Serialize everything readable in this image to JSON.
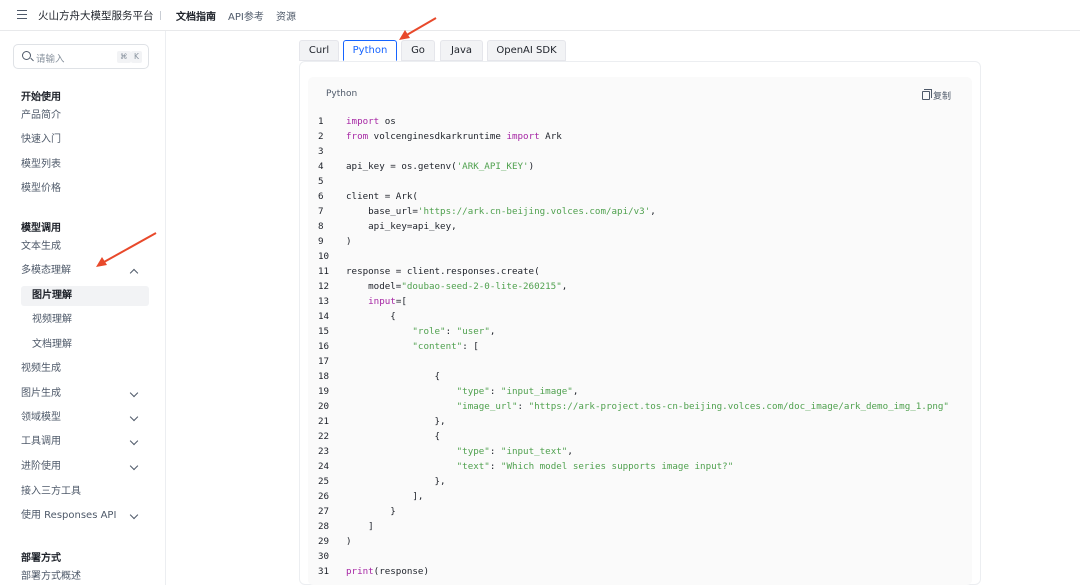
{
  "topbar": {
    "brand": "火山方舟大模型服务平台",
    "nav": [
      {
        "label": "文档指南",
        "active": true
      },
      {
        "label": "API参考",
        "active": false
      },
      {
        "label": "资源",
        "active": false
      }
    ]
  },
  "sidebar": {
    "search": {
      "placeholder": "请输入",
      "shortcut_mod": "⌘",
      "shortcut_key": "K"
    },
    "sections": [
      {
        "title": "开始使用"
      },
      {
        "title": "模型调用"
      },
      {
        "title": "部署方式"
      }
    ],
    "items": [
      {
        "label": "产品简介"
      },
      {
        "label": "快速入门"
      },
      {
        "label": "模型列表"
      },
      {
        "label": "模型价格"
      },
      {
        "label": "文本生成"
      },
      {
        "label": "多模态理解"
      },
      {
        "label": "图片理解"
      },
      {
        "label": "视频理解"
      },
      {
        "label": "文档理解"
      },
      {
        "label": "视频生成"
      },
      {
        "label": "图片生成"
      },
      {
        "label": "领域模型"
      },
      {
        "label": "工具调用"
      },
      {
        "label": "进阶使用"
      },
      {
        "label": "接入三方工具"
      },
      {
        "label": "使用 Responses API"
      },
      {
        "label": "部署方式概述"
      }
    ]
  },
  "tabs": [
    {
      "label": "Curl"
    },
    {
      "label": "Python"
    },
    {
      "label": "Go"
    },
    {
      "label": "Java"
    },
    {
      "label": "OpenAI SDK"
    }
  ],
  "code": {
    "language": "Python",
    "copy_label": "复制",
    "lines": [
      [
        {
          "t": "kw",
          "v": "import"
        },
        {
          "t": "plain",
          "v": " os"
        }
      ],
      [
        {
          "t": "kw",
          "v": "from"
        },
        {
          "t": "plain",
          "v": " volcenginesdkarkruntime "
        },
        {
          "t": "kw",
          "v": "import"
        },
        {
          "t": "plain",
          "v": " Ark"
        }
      ],
      [],
      [
        {
          "t": "plain",
          "v": "api_key = os.getenv("
        },
        {
          "t": "str",
          "v": "'ARK_API_KEY'"
        },
        {
          "t": "plain",
          "v": ")"
        }
      ],
      [],
      [
        {
          "t": "plain",
          "v": "client = Ark("
        }
      ],
      [
        {
          "t": "plain",
          "v": "    base_url="
        },
        {
          "t": "str",
          "v": "'https://ark.cn-beijing.volces.com/api/v3'"
        },
        {
          "t": "plain",
          "v": ","
        }
      ],
      [
        {
          "t": "plain",
          "v": "    api_key=api_key,"
        }
      ],
      [
        {
          "t": "plain",
          "v": ")"
        }
      ],
      [],
      [
        {
          "t": "plain",
          "v": "response = client.responses.create("
        }
      ],
      [
        {
          "t": "plain",
          "v": "    model="
        },
        {
          "t": "str",
          "v": "\"doubao-seed-2-0-lite-260215\""
        },
        {
          "t": "plain",
          "v": ","
        }
      ],
      [
        {
          "t": "plain",
          "v": "    "
        },
        {
          "t": "kw",
          "v": "input"
        },
        {
          "t": "plain",
          "v": "=["
        }
      ],
      [
        {
          "t": "plain",
          "v": "        {"
        }
      ],
      [
        {
          "t": "plain",
          "v": "            "
        },
        {
          "t": "str",
          "v": "\"role\""
        },
        {
          "t": "plain",
          "v": ": "
        },
        {
          "t": "str",
          "v": "\"user\""
        },
        {
          "t": "plain",
          "v": ","
        }
      ],
      [
        {
          "t": "plain",
          "v": "            "
        },
        {
          "t": "str",
          "v": "\"content\""
        },
        {
          "t": "plain",
          "v": ": ["
        }
      ],
      [],
      [
        {
          "t": "plain",
          "v": "                {"
        }
      ],
      [
        {
          "t": "plain",
          "v": "                    "
        },
        {
          "t": "str",
          "v": "\"type\""
        },
        {
          "t": "plain",
          "v": ": "
        },
        {
          "t": "str",
          "v": "\"input_image\""
        },
        {
          "t": "plain",
          "v": ","
        }
      ],
      [
        {
          "t": "plain",
          "v": "                    "
        },
        {
          "t": "str",
          "v": "\"image_url\""
        },
        {
          "t": "plain",
          "v": ": "
        },
        {
          "t": "str",
          "v": "\"https://ark-project.tos-cn-beijing.volces.com/doc_image/ark_demo_img_1.png\""
        }
      ],
      [
        {
          "t": "plain",
          "v": "                },"
        }
      ],
      [
        {
          "t": "plain",
          "v": "                {"
        }
      ],
      [
        {
          "t": "plain",
          "v": "                    "
        },
        {
          "t": "str",
          "v": "\"type\""
        },
        {
          "t": "plain",
          "v": ": "
        },
        {
          "t": "str",
          "v": "\"input_text\""
        },
        {
          "t": "plain",
          "v": ","
        }
      ],
      [
        {
          "t": "plain",
          "v": "                    "
        },
        {
          "t": "str",
          "v": "\"text\""
        },
        {
          "t": "plain",
          "v": ": "
        },
        {
          "t": "str",
          "v": "\"Which model series supports image input?\""
        }
      ],
      [
        {
          "t": "plain",
          "v": "                },"
        }
      ],
      [
        {
          "t": "plain",
          "v": "            ],"
        }
      ],
      [
        {
          "t": "plain",
          "v": "        }"
        }
      ],
      [
        {
          "t": "plain",
          "v": "    ]"
        }
      ],
      [
        {
          "t": "plain",
          "v": ")"
        }
      ],
      [],
      [
        {
          "t": "kw",
          "v": "print"
        },
        {
          "t": "plain",
          "v": "(response)"
        }
      ]
    ]
  },
  "colors": {
    "accent": "#1664ff",
    "annotation_arrow": "#e8492b"
  },
  "annotations": [
    {
      "icon": "red-arrow-icon"
    },
    {
      "icon": "red-arrow-icon"
    }
  ]
}
